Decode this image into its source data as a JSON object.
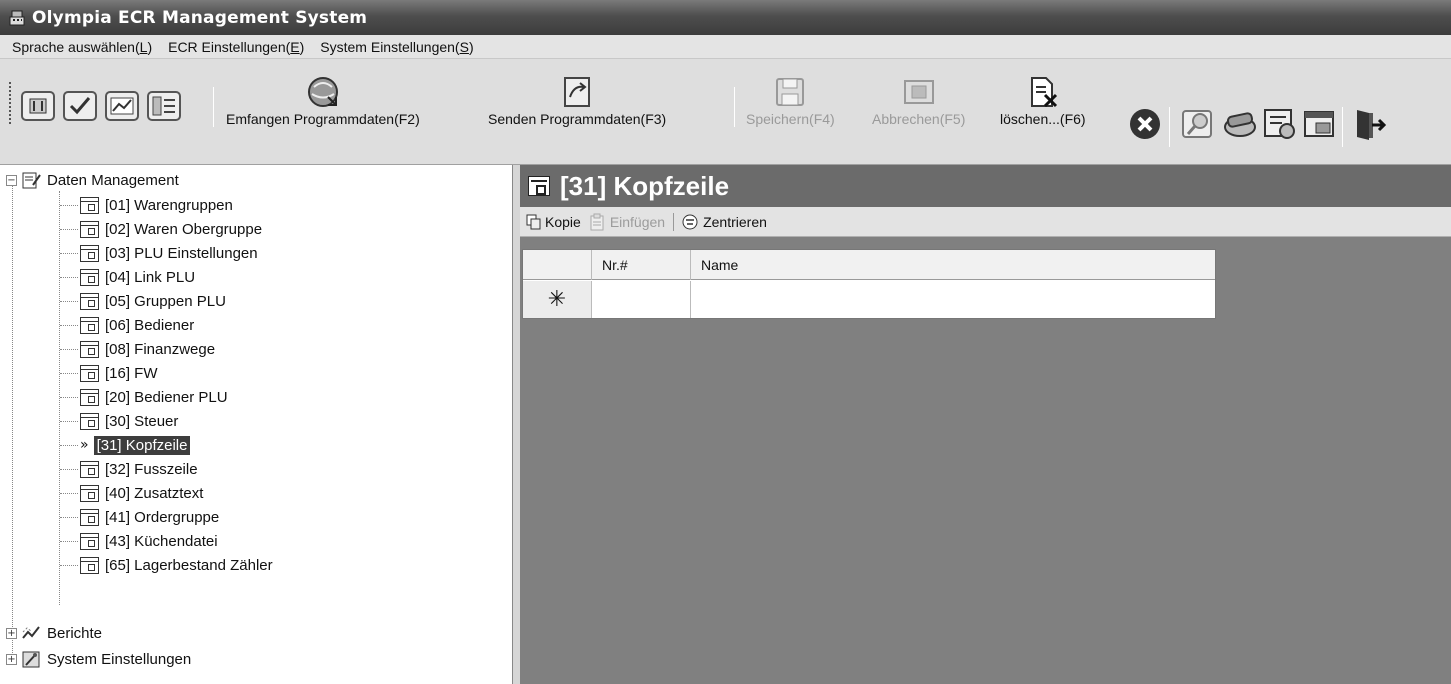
{
  "window": {
    "title": "Olympia ECR Management System"
  },
  "menu": {
    "items": [
      {
        "label": "Sprache auswählen(",
        "acc": "L",
        "end": ")"
      },
      {
        "label": "ECR Einstellungen(",
        "acc": "E",
        "end": ")"
      },
      {
        "label": "System Einstellungen(",
        "acc": "S",
        "end": ")"
      }
    ]
  },
  "toolbar": {
    "receive_label": "Emfangen Programmdaten(F2)",
    "send_label": "Senden Programmdaten(F3)",
    "save_label": "Speichern(F4)",
    "cancel_label": "Abbrechen(F5)",
    "delete_label": "löschen...(F6)"
  },
  "tree": {
    "root": "Daten Management",
    "items": [
      "[01] Warengruppen",
      "[02] Waren Obergruppe",
      "[03] PLU Einstellungen",
      "[04] Link PLU",
      "[05] Gruppen PLU",
      "[06] Bediener",
      "[08] Finanzwege",
      "[16] FW",
      "[20] Bediener PLU",
      "[30] Steuer",
      "[31] Kopfzeile",
      "[32] Fusszeile",
      "[40] Zusatztext",
      "[41] Ordergruppe",
      "[43] Küchendatei",
      "[65] Lagerbestand Zähler"
    ],
    "selected_marker": "»",
    "reports": "Berichte",
    "system": "System Einstellungen"
  },
  "main": {
    "title": "[31] Kopfzeile",
    "copy_label": "Kopie",
    "paste_label": "Einfügen",
    "center_label": "Zentrieren",
    "columns": [
      "Nr.#",
      "Name"
    ],
    "new_row_marker": "✳"
  }
}
